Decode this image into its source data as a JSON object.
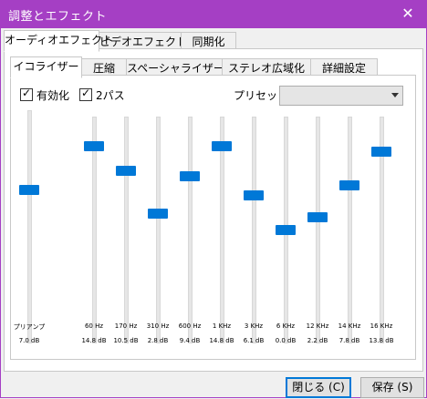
{
  "window": {
    "title": "調整とエフェクト",
    "close_glyph": "✕"
  },
  "tabs": [
    {
      "label": "オーディオエフェクト"
    },
    {
      "label": "ビデオエフェクト"
    },
    {
      "label": "同期化"
    }
  ],
  "subtabs": [
    {
      "label": "イコライザー"
    },
    {
      "label": "圧縮"
    },
    {
      "label": "スペーシャライザー"
    },
    {
      "label": "ステレオ広域化"
    },
    {
      "label": "詳細設定"
    }
  ],
  "options": {
    "enable_label": "有効化",
    "enable_checked": true,
    "twopass_label": "2パス",
    "twopass_checked": true,
    "preset_label": "プリセット",
    "preset_value": ""
  },
  "preamp": {
    "label": "プリアンプ",
    "gain": "7.0 dB",
    "level": 7.0
  },
  "bands": [
    {
      "freq": "60 Hz",
      "gain": "14.8 dB",
      "level": 14.8
    },
    {
      "freq": "170 Hz",
      "gain": "10.5 dB",
      "level": 10.5
    },
    {
      "freq": "310 Hz",
      "gain": "2.8 dB",
      "level": 2.8
    },
    {
      "freq": "600 Hz",
      "gain": "9.4 dB",
      "level": 9.4
    },
    {
      "freq": "1 KHz",
      "gain": "14.8 dB",
      "level": 14.8
    },
    {
      "freq": "3 KHz",
      "gain": "6.1 dB",
      "level": 6.1
    },
    {
      "freq": "6 KHz",
      "gain": "0.0 dB",
      "level": 0.0
    },
    {
      "freq": "12 KHz",
      "gain": "2.2 dB",
      "level": 2.2
    },
    {
      "freq": "14 KHz",
      "gain": "7.8 dB",
      "level": 7.8
    },
    {
      "freq": "16 KHz",
      "gain": "13.8 dB",
      "level": 13.8
    }
  ],
  "buttons": {
    "close": "閉じる (C)",
    "save": "保存 (S)"
  },
  "colors": {
    "titlebar": "#a53fc4",
    "thumb": "#0078d7"
  }
}
